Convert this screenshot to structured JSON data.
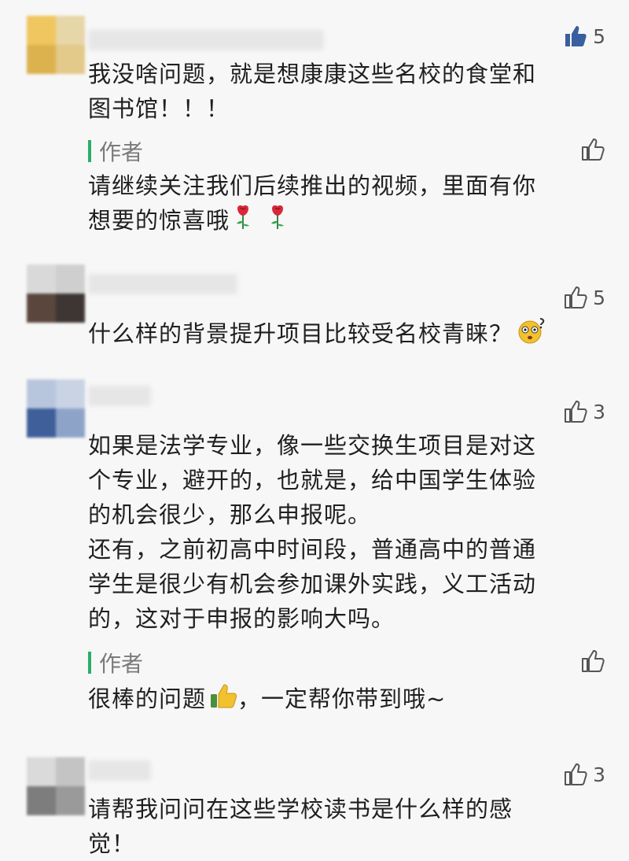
{
  "comments": [
    {
      "likes": "5",
      "text": "我没啥问题，就是想康康这些名校的食堂和\n图书馆！！！",
      "reply": {
        "author": "作者",
        "text": "请继续关注我们后续推出的视频，里面有你\n想要的惊喜哦"
      }
    },
    {
      "likes": "5",
      "text": "什么样的背景提升项目比较受名校青睐？"
    },
    {
      "likes": "3",
      "text": "如果是法学专业，像一些交换生项目是对这\n个专业，避开的，也就是，给中国学生体验\n的机会很少，那么申报呢。\n还有，之前初高中时间段，普通高中的普通\n学生是很少有机会参加课外实践，义工活动\n的，这对于申报的影响大吗。",
      "reply": {
        "author": "作者",
        "text_before": "很棒的问题",
        "text_after": "，一定帮你带到哦~"
      }
    },
    {
      "likes": "3",
      "text": "请帮我问问在这些学校读书是什么样的感\n觉！"
    }
  ],
  "icons": {
    "like": "thumbs-up-icon",
    "reply_emoji_1": "rose-icon",
    "comment2_emoji": "confused-face-icon",
    "reply2_emoji": "thumbs-up-emoji-icon"
  },
  "colors": {
    "author_bar": "#2aae67",
    "liked": "#3a5f9e"
  }
}
